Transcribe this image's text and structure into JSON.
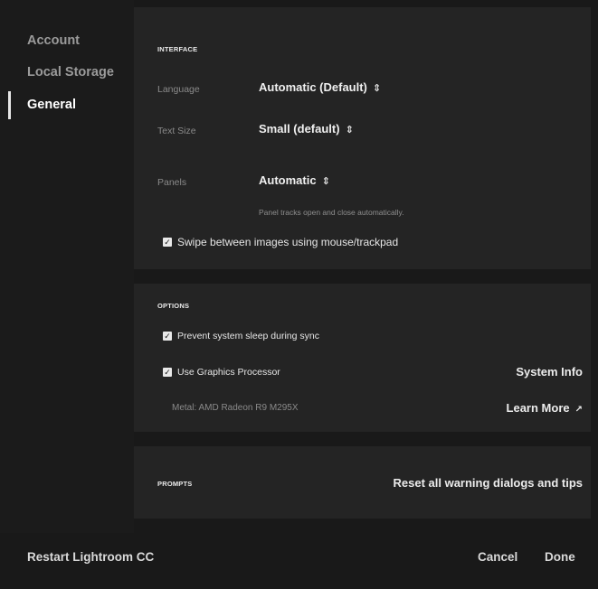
{
  "sidebar": {
    "items": [
      {
        "label": "Account"
      },
      {
        "label": "Local Storage"
      },
      {
        "label": "General"
      }
    ]
  },
  "interface": {
    "title": "INTERFACE",
    "language": {
      "label": "Language",
      "value": "Automatic (Default)"
    },
    "text_size": {
      "label": "Text Size",
      "value": "Small (default)"
    },
    "panels": {
      "label": "Panels",
      "value": "Automatic",
      "hint": "Panel tracks open and close automatically."
    },
    "swipe": {
      "label": "Swipe between images using mouse/trackpad",
      "checked": true
    }
  },
  "options": {
    "title": "OPTIONS",
    "prevent_sleep": {
      "label": "Prevent system sleep during sync",
      "checked": true
    },
    "gpu": {
      "label": "Use Graphics Processor",
      "checked": true
    },
    "gpu_info": "Metal: AMD Radeon R9 M295X",
    "system_info": "System Info",
    "learn_more": "Learn More"
  },
  "prompts": {
    "title": "PROMPTS",
    "reset": "Reset all warning dialogs and tips"
  },
  "footer": {
    "restart": "Restart Lightroom CC",
    "cancel": "Cancel",
    "done": "Done"
  },
  "icons": {
    "dropdown_arrow": "updown-arrow-icon",
    "checkbox": "checkmark-icon",
    "external_link": "external-link-icon"
  },
  "colors": {
    "background": "#191919",
    "panel": "#242424",
    "text_primary": "#f0f0f0",
    "text_secondary": "#8a8a8a"
  }
}
